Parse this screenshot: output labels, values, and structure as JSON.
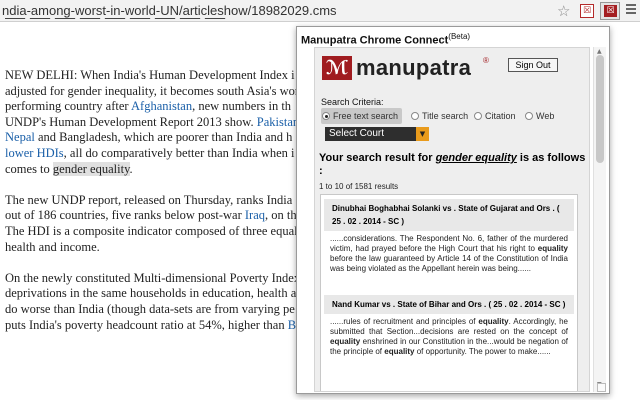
{
  "browser": {
    "url": "ndia-among-worst-in-world-UN/articleshow/18982029.cms",
    "star_icon": "star-icon",
    "extensions": [
      "extension-icon",
      "manupatra-extension-icon"
    ]
  },
  "article": {
    "paragraphs": [
      [
        {
          "t": "NEW DELHI: When India's Human Development Index i"
        },
        {
          "t": "adjusted for gender inequality, it becomes south Asia's wor"
        },
        {
          "t": "performing country after "
        },
        {
          "t": "Afghanistan",
          "link": true
        },
        {
          "t": ", new numbers in th"
        },
        {
          "t": "UNDP's Human Development Report 2013 show. "
        },
        {
          "t": "Pakistan",
          "link": true
        },
        {
          "t": "Nepal",
          "link": true
        },
        {
          "t": " and Bangladesh, which are poorer than India and h"
        },
        {
          "t": "lower HDIs",
          "link": true
        },
        {
          "t": ", all do comparatively better than India when i"
        },
        {
          "t": "comes to "
        },
        {
          "t": "gender equality",
          "hl": true
        },
        {
          "t": "."
        }
      ]
    ],
    "lines": [
      [
        {
          "t": "NEW DELHI: When India's Human Development Index i"
        }
      ],
      [
        {
          "t": "adjusted for gender inequality, it becomes south Asia's wor"
        }
      ],
      [
        {
          "t": "performing country after "
        },
        {
          "t": "Afghanistan",
          "link": true
        },
        {
          "t": ", new numbers in th"
        }
      ],
      [
        {
          "t": "UNDP's Human Development Report 2013 show. "
        },
        {
          "t": "Pakistan",
          "link": true
        }
      ],
      [
        {
          "t": "Nepal",
          "link": true
        },
        {
          "t": " and Bangladesh, which are poorer than India and h"
        }
      ],
      [
        {
          "t": "lower HDIs",
          "link": true
        },
        {
          "t": ", all do comparatively better than India when i"
        }
      ],
      [
        {
          "t": "comes to "
        },
        {
          "t": "gender equality",
          "hl": true
        },
        {
          "t": "."
        }
      ],
      [
        {
          "t": ""
        }
      ],
      [
        {
          "t": "The new UNDP report, released on Thursday, ranks India"
        }
      ],
      [
        {
          "t": "out of 186 countries, five ranks below post-war "
        },
        {
          "t": "Iraq",
          "link": true
        },
        {
          "t": ", on th"
        }
      ],
      [
        {
          "t": "The HDI is a composite indicator composed of three equal"
        }
      ],
      [
        {
          "t": "health and income."
        }
      ],
      [
        {
          "t": ""
        }
      ],
      [
        {
          "t": "On the newly constituted Multi-dimensional Poverty Index"
        }
      ],
      [
        {
          "t": "deprivations in the same households in education, health a"
        }
      ],
      [
        {
          "t": "do worse than India (though data-sets are from varying pe"
        }
      ],
      [
        {
          "t": "puts India's poverty headcount ratio at 54%, higher than "
        },
        {
          "t": "B",
          "link": true
        }
      ]
    ]
  },
  "popup": {
    "title": "Manupatra Chrome Connect",
    "title_sup": "(Beta)",
    "logo_text": "manupatra",
    "logo_reg": "®",
    "sign_out": "Sign Out",
    "criteria_label": "Search Criteria:",
    "options": [
      {
        "label": "Free text search",
        "selected": true
      },
      {
        "label": "Title search",
        "selected": false
      },
      {
        "label": "Citation",
        "selected": false
      },
      {
        "label": "Web",
        "selected": false
      }
    ],
    "select_court": "Select Court",
    "result_prefix": "Your search result for ",
    "result_query": "gender equality",
    "result_suffix": " is as follows :",
    "result_count": "1 to 10 of 1581 results",
    "results": [
      {
        "title": "Dinubhai Boghabhai Solanki vs . State of Gujarat and Ors . ( 25 . 02 . 2014 - SC )",
        "snippet": [
          {
            "t": "......considerations. The Respondent No. 6, father of the murdered victim, had prayed before the High Court that his right to "
          },
          {
            "t": "equality",
            "b": true
          },
          {
            "t": " before the law guaranteed by Article 14 of the Constitution of India was being violated as the Appellant herein was being......"
          }
        ]
      },
      {
        "title": "Nand Kumar vs . State of Bihar and Ors . ( 25 . 02 . 2014 - SC )",
        "snippet": [
          {
            "t": "......rules of recruitment and principles of "
          },
          {
            "t": "equality",
            "b": true
          },
          {
            "t": ". Accordingly, he submitted that Section...decisions are rested on the concept of "
          },
          {
            "t": "equality",
            "b": true
          },
          {
            "t": " enshrined in our Constitution in the...would be negation of the principle of "
          },
          {
            "t": "equality",
            "b": true
          },
          {
            "t": " of opportunity. The power to make......"
          }
        ]
      }
    ]
  }
}
